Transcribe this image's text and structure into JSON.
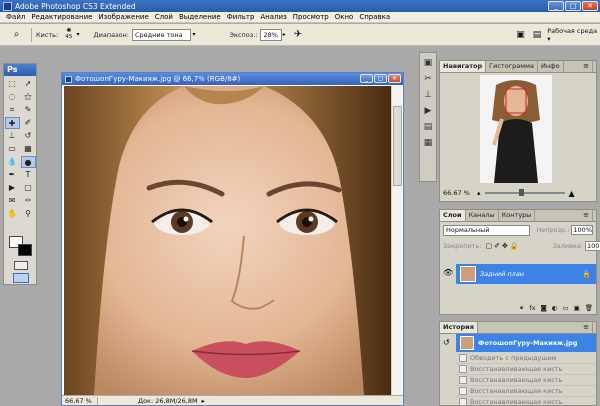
{
  "window": {
    "title": "Adobe Photoshop CS3 Extended",
    "min": "_",
    "max": "□",
    "close": "✕"
  },
  "menu": [
    "Файл",
    "Редактирование",
    "Изображение",
    "Слой",
    "Выделение",
    "Фильтр",
    "Анализ",
    "Просмотр",
    "Окно",
    "Справка"
  ],
  "options": {
    "brushes_label": "Кисть:",
    "brush_size": "45",
    "range_label": "Диапазон:",
    "range_value": "Средние тона",
    "exposure_label": "Экспоз.:",
    "exposure_value": "28%",
    "workspace_label": "Рабочая среда ▾"
  },
  "toolbox": {
    "logo": "Ps"
  },
  "document": {
    "title": "ФотошопГуру-Макияж.jpg @ 66,7% (RGB/8#)",
    "zoom": "66,67 %",
    "doc_info": "Док: 26,8M/26,8M"
  },
  "navigator": {
    "tabs": [
      "Навигатор",
      "Гистограмма",
      "Инфо"
    ],
    "zoom": "66.67 %"
  },
  "layers": {
    "tabs": [
      "Слои",
      "Каналы",
      "Контуры"
    ],
    "blend_mode": "Нормальный",
    "opacity_label": "Непрозр.:",
    "opacity_value": "100%",
    "lock_label": "Закрепить:",
    "fill_label": "Заливка:",
    "fill_value": "100%",
    "layer_name": "Задний план"
  },
  "history": {
    "tab": "История",
    "snapshot": "ФотошопГуру-Макияж.jpg",
    "items": [
      "Обводить с предыдущим",
      "Восстанавливающая кисть",
      "Восстанавливающая кисть",
      "Восстанавливающая кисть",
      "Восстанавливающая кисть"
    ]
  },
  "colors": {
    "accent": "#3d82e6",
    "title_blue": "#2a5aa8"
  }
}
